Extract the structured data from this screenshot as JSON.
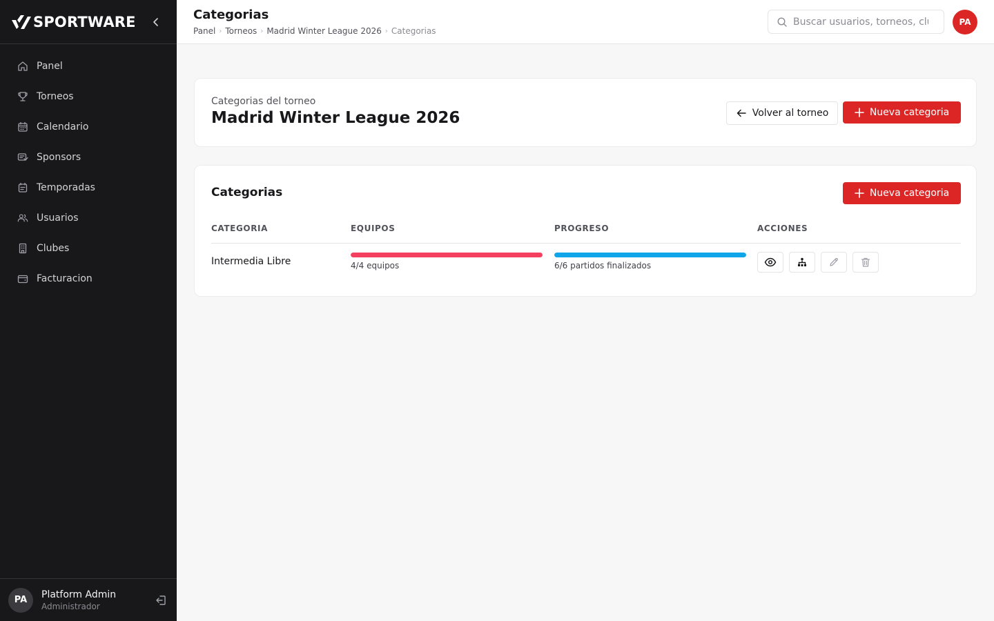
{
  "brand": {
    "name": "SPORTWARE"
  },
  "sidebar": {
    "items": [
      {
        "label": "Panel",
        "icon": "home-icon"
      },
      {
        "label": "Torneos",
        "icon": "trophy-icon"
      },
      {
        "label": "Calendario",
        "icon": "calendar-icon"
      },
      {
        "label": "Sponsors",
        "icon": "sponsor-icon"
      },
      {
        "label": "Temporadas",
        "icon": "calendar-list-icon"
      },
      {
        "label": "Usuarios",
        "icon": "users-icon"
      },
      {
        "label": "Clubes",
        "icon": "building-icon"
      },
      {
        "label": "Facturacion",
        "icon": "wallet-icon"
      }
    ],
    "user": {
      "initials": "PA",
      "name": "Platform Admin",
      "role": "Administrador"
    }
  },
  "header": {
    "title": "Categorias",
    "breadcrumb": [
      "Panel",
      "Torneos",
      "Madrid Winter League 2026",
      "Categorias"
    ],
    "search_placeholder": "Buscar usuarios, torneos, clubes...",
    "avatar_initials": "PA"
  },
  "tournament_card": {
    "subtitle": "Categorias del torneo",
    "title": "Madrid Winter League 2026",
    "back_label": "Volver al torneo",
    "new_label": "Nueva categoria"
  },
  "categories_card": {
    "title": "Categorias",
    "new_label": "Nueva categoria",
    "columns": [
      "CATEGORIA",
      "EQUIPOS",
      "PROGRESO",
      "ACCIONES"
    ],
    "rows": [
      {
        "name": "Intermedia Libre",
        "teams_caption": "4/4 equipos",
        "teams_fraction": 1.0,
        "progress_caption": "6/6 partidos finalizados",
        "progress_fraction": 1.0
      }
    ]
  },
  "colors": {
    "accent": "#dc2626",
    "sidebar_bg": "#18181b",
    "teams_bar": "#f43f5e",
    "progress_bar": "#0ea5e9"
  }
}
